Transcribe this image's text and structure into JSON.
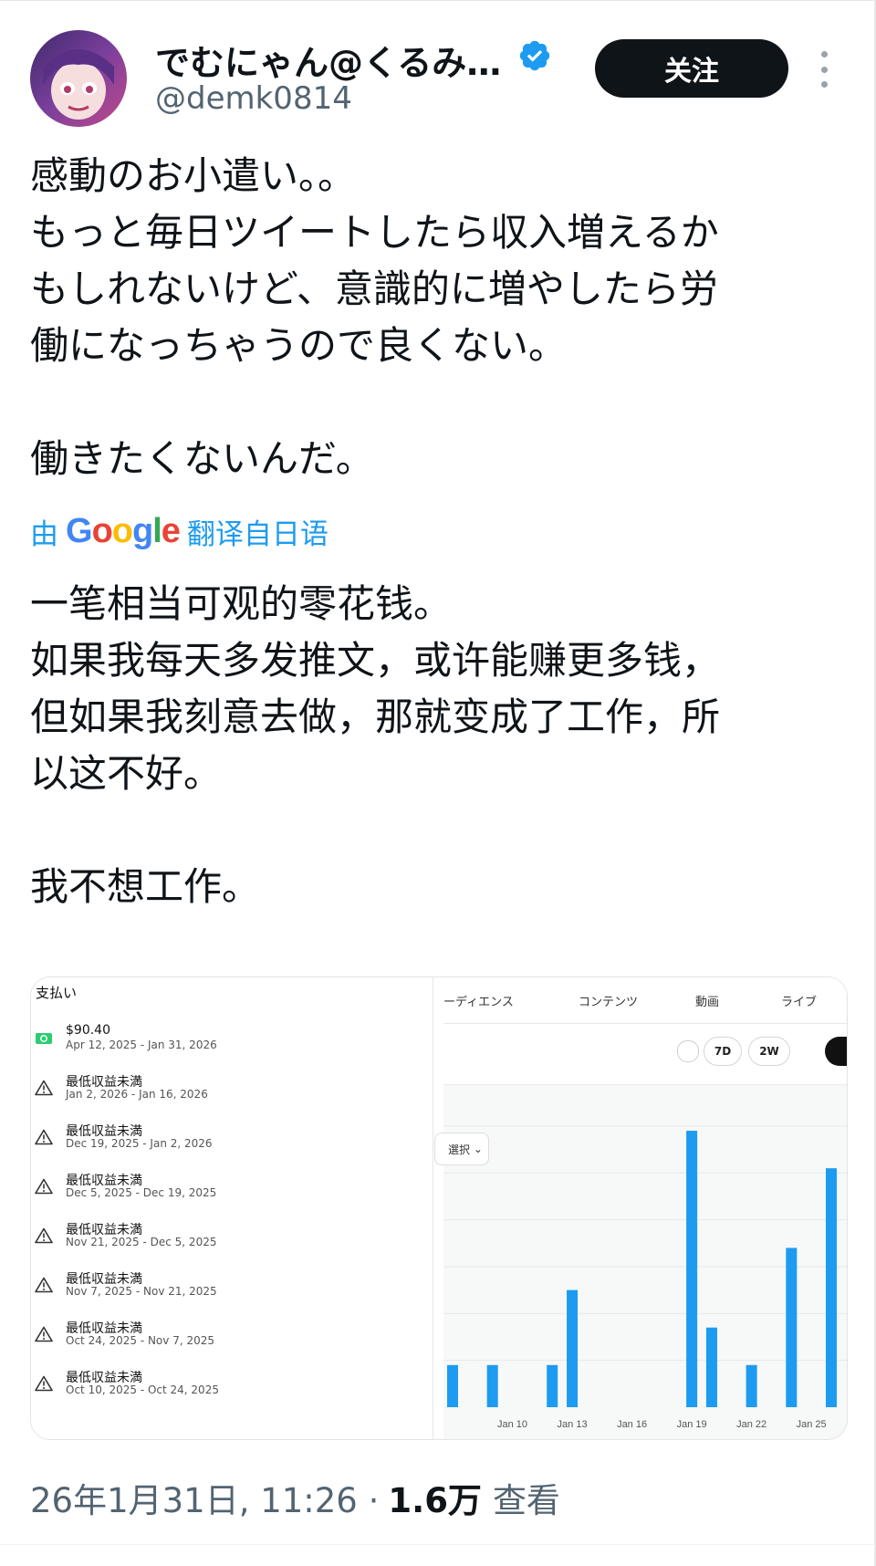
{
  "author": {
    "display_name": "でむにゃん@くるみ…",
    "handle": "@demk0814",
    "follow_label": "关注"
  },
  "tweet": {
    "original_text": "感動のお小遣い。。\nもっと毎日ツイートしたら収入増えるか\nもしれないけど、意識的に増やしたら労\n働になっちゃうので良くない。\n\n働きたくないんだ。",
    "translate_prefix": "由",
    "translate_brand": "Google",
    "translate_suffix": "翻译自日语",
    "translated_text": "一笔相当可观的零花钱。\n如果我每天多发推文，或许能赚更多钱，\n但如果我刻意去做，那就变成了工作，所\n以这不好。\n\n我不想工作。"
  },
  "payments": {
    "title": "支払い",
    "rows": [
      {
        "label": "$90.40",
        "range": "Apr 12, 2025 - Jan 31, 2026",
        "icon": "money-icon"
      },
      {
        "label": "最低収益未満",
        "range": "Jan 2, 2026 - Jan 16, 2026",
        "icon": "warning-icon"
      },
      {
        "label": "最低収益未満",
        "range": "Dec 19, 2025 - Jan 2, 2026",
        "icon": "warning-icon"
      },
      {
        "label": "最低収益未満",
        "range": "Dec 5, 2025 - Dec 19, 2025",
        "icon": "warning-icon"
      },
      {
        "label": "最低収益未満",
        "range": "Nov 21, 2025 - Dec 5, 2025",
        "icon": "warning-icon"
      },
      {
        "label": "最低収益未満",
        "range": "Nov 7, 2025 - Nov 21, 2025",
        "icon": "warning-icon"
      },
      {
        "label": "最低収益未満",
        "range": "Oct 24, 2025 - Nov 7, 2025",
        "icon": "warning-icon"
      },
      {
        "label": "最低収益未満",
        "range": "Oct 10, 2025 - Oct 24, 2025",
        "icon": "warning-icon"
      }
    ]
  },
  "analytics": {
    "tabs": [
      "ーディエンス",
      "コンテンツ",
      "動画",
      "ライブ"
    ],
    "range_buttons": [
      "7D",
      "2W"
    ],
    "select_label": "選択"
  },
  "chart_data": {
    "type": "bar",
    "x_tick_labels": [
      "Jan 10",
      "Jan 13",
      "Jan 16",
      "Jan 19",
      "Jan 22",
      "Jan 25"
    ],
    "x": [
      "Jan 7",
      "Jan 9",
      "Jan 12",
      "Jan 13",
      "Jan 19",
      "Jan 20",
      "Jan 22",
      "Jan 24",
      "Jan 26"
    ],
    "values": [
      0.9,
      0.9,
      0.9,
      2.5,
      5.9,
      1.7,
      0.9,
      3.4,
      5.1
    ],
    "bar_color": "#1d9bf0",
    "grid": true,
    "xlim": [
      "Jan 7",
      "Jan 26"
    ]
  },
  "footer": {
    "timestamp": "26年1月31日, 11:26 ·",
    "views": "1.6万",
    "views_label": "查看"
  },
  "colors": {
    "accent": "#1d9bf0",
    "text": "#0f1419",
    "secondary": "#536471"
  }
}
